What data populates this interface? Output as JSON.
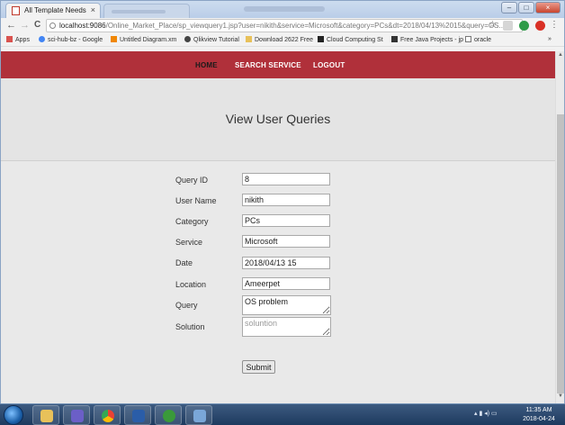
{
  "browser": {
    "tab_title": "All Template Needs",
    "tab_close": "×",
    "url_host": "localhost:9086",
    "url_path": "/Online_Market_Place/sp_viewquery1.jsp?user=nikith&service=Microsoft&category=PCs&dt=2018/04/13%2015&query=OS...",
    "back_glyph": "←",
    "forward_glyph": "→",
    "reload_glyph": "C",
    "star_glyph": "☆",
    "menu_glyph": "⋮",
    "more_bookmarks": "»",
    "window_buttons": {
      "minimize": "–",
      "maximize": "□",
      "close": "×"
    },
    "bookmarks": [
      {
        "label": "Apps",
        "icon": "apps-grid-icon",
        "color": "#d9534f"
      },
      {
        "label": "sci-hub-bz - Google",
        "icon": "google-icon",
        "color": "#4285f4"
      },
      {
        "label": "Untitled Diagram.xm",
        "icon": "drawio-icon",
        "color": "#f08705"
      },
      {
        "label": "Qlikview Tutorial",
        "icon": "qlik-icon",
        "color": "#444444"
      },
      {
        "label": "Download 2622 Free",
        "icon": "folder-icon",
        "color": "#e8c15a"
      },
      {
        "label": "Cloud Computing St",
        "icon": "b-icon",
        "color": "#222222"
      },
      {
        "label": "Free Java Projects - jp",
        "icon": "t-icon",
        "color": "#333333"
      },
      {
        "label": "oracle",
        "icon": "page-icon",
        "color": "#777777"
      }
    ]
  },
  "nav": {
    "home": "HOME",
    "search_service": "SEARCH SERVICE",
    "logout": "LOGOUT"
  },
  "page_title": "View User Queries",
  "form": {
    "labels": {
      "query_id": "Query ID",
      "user_name": "User Name",
      "category": "Category",
      "service": "Service",
      "date": "Date",
      "location": "Location",
      "query": "Query",
      "solution": "Solution"
    },
    "values": {
      "query_id": "8",
      "user_name": "nikith",
      "category": "PCs",
      "service": "Microsoft",
      "date": "2018/04/13 15",
      "location": "Ameerpet",
      "query": "OS problem"
    },
    "solution_placeholder": "soluntion",
    "submit_label": "Submit"
  },
  "taskbar": {
    "apps": [
      {
        "name": "explorer",
        "color": "#e8c15a"
      },
      {
        "name": "eclipse",
        "color": "#6b5fc7"
      },
      {
        "name": "chrome",
        "color": "#e94235"
      },
      {
        "name": "virtualbox",
        "color": "#2a5da8"
      },
      {
        "name": "qlikview",
        "color": "#3a9a3a"
      },
      {
        "name": "notepad",
        "color": "#7aa7d8"
      }
    ],
    "time": "11:35 AM",
    "date": "2018-04-24"
  },
  "colors": {
    "navbar": "#b0303a",
    "hero": "#e4e4e4",
    "content": "#e9e9e9"
  }
}
